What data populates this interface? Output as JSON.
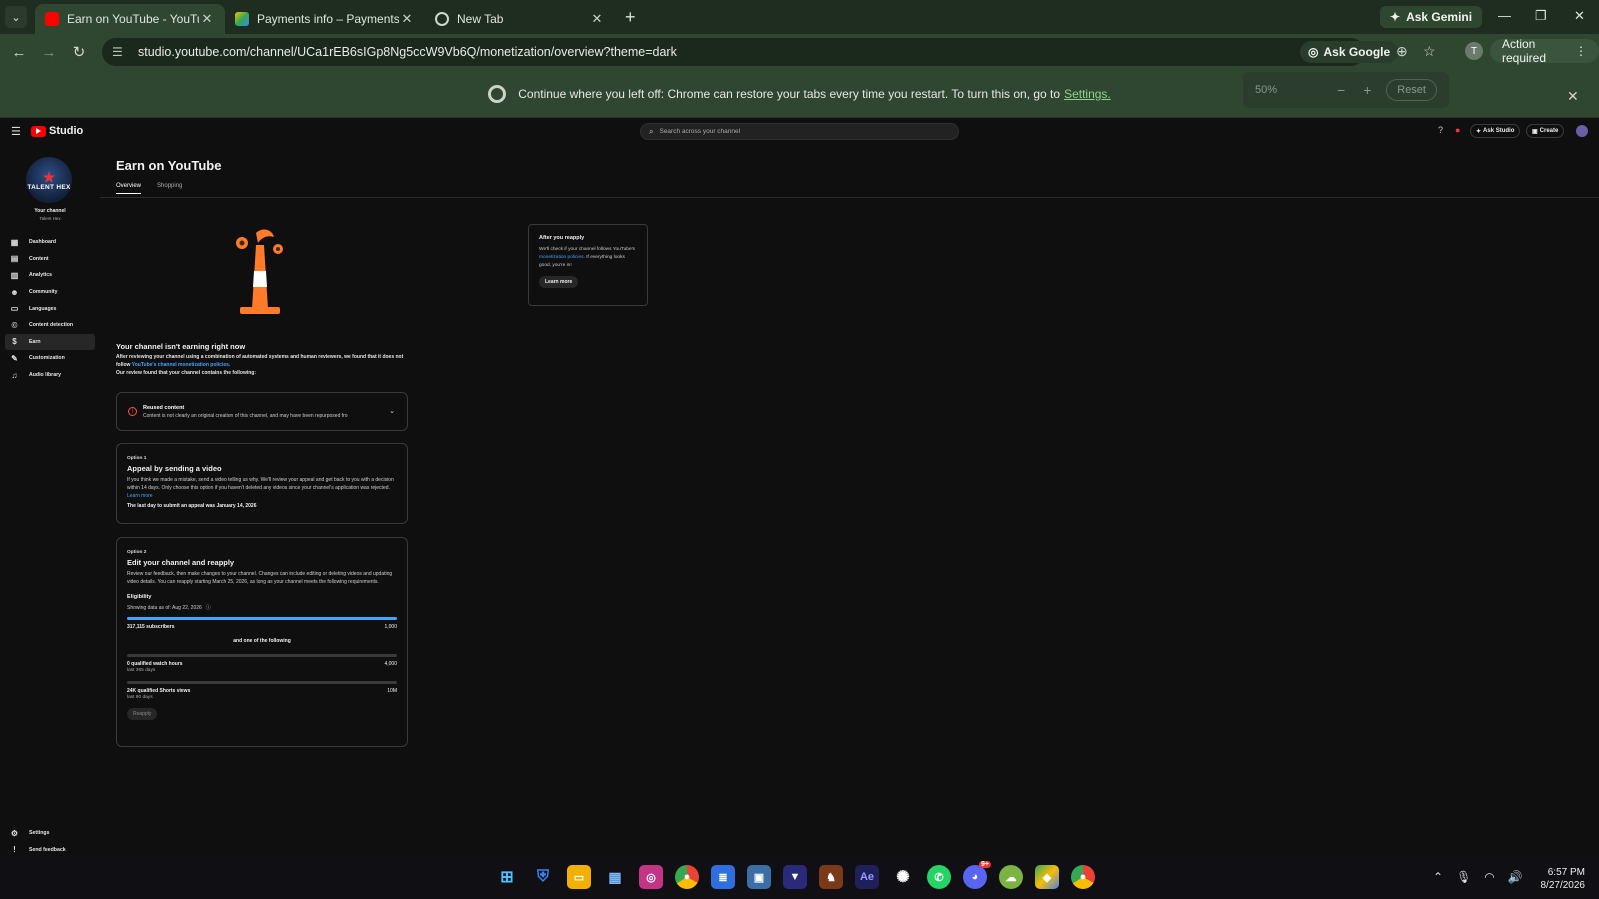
{
  "browser": {
    "tabs": [
      {
        "title": "Earn on YouTube - YouTube Stu",
        "favicon": "youtube-icon",
        "active": true
      },
      {
        "title": "Payments info – Payments – Go",
        "favicon": "google-pay-icon",
        "active": false
      },
      {
        "title": "New Tab",
        "favicon": "chrome-icon",
        "active": false
      }
    ],
    "ask_gemini": "Ask Gemini",
    "url": "studio.youtube.com/channel/UCa1rEB6sIGp8Ng5ccW9Vb6Q/monetization/overview?theme=dark",
    "ask_google": "Ask Google",
    "profile_initial": "T",
    "action_required": "Action required",
    "restore_message": "Continue where you left off: Chrome can restore your tabs every time you restart. To turn this on, go to",
    "restore_link": "Settings.",
    "zoom": {
      "level": "50%",
      "reset": "Reset"
    }
  },
  "studio": {
    "logo_text": "Studio",
    "search_placeholder": "Search across your channel",
    "ask_studio": "Ask Studio",
    "create": "Create"
  },
  "sidebar": {
    "channel_avatar_text": "TALENT HEX",
    "your_channel": "Your channel",
    "channel_name": "Talent Hex",
    "items": [
      {
        "label": "Dashboard",
        "icon": "dashboard-icon"
      },
      {
        "label": "Content",
        "icon": "content-icon"
      },
      {
        "label": "Analytics",
        "icon": "analytics-icon"
      },
      {
        "label": "Community",
        "icon": "community-icon"
      },
      {
        "label": "Languages",
        "icon": "languages-icon"
      },
      {
        "label": "Content detection",
        "icon": "content-detection-icon"
      },
      {
        "label": "Earn",
        "icon": "earn-icon",
        "active": true
      },
      {
        "label": "Customization",
        "icon": "customization-icon"
      },
      {
        "label": "Audio library",
        "icon": "audio-library-icon"
      }
    ],
    "bottom": [
      {
        "label": "Settings",
        "icon": "gear-icon"
      },
      {
        "label": "Send feedback",
        "icon": "feedback-icon"
      }
    ]
  },
  "main": {
    "title": "Earn on YouTube",
    "tabs": [
      "Overview",
      "Shopping"
    ],
    "not_earning_title": "Your channel isn't earning right now",
    "review_text_1": "After reviewing your channel using a combination of automated systems and human reviewers, we found that it does not follow",
    "review_link": "YouTube's channel monetization policies.",
    "review_text_2": "Our review found that your channel contains the following:",
    "reused": {
      "title": "Reused content",
      "desc": "Content is not clearly an original creation of this channel, and may have been repurposed fro"
    },
    "option1": {
      "label": "Option 1",
      "title": "Appeal by sending a video",
      "text": "If you think we made a mistake, send a video telling us why. We'll review your appeal and get back to you with a decision within 14 days. Only choose this option if you haven't deleted any videos since your channel's application was rejected.",
      "link": "Learn more",
      "deadline": "The last day to submit an appeal was January 14, 2026"
    },
    "option2": {
      "label": "Option 2",
      "title": "Edit your channel and reapply",
      "text": "Review our feedback, then make changes to your channel. Changes can include editing or deleting videos and updating video details. You can reapply starting March 25, 2026, as long as your channel meets the following requirements.",
      "eligibility": "Eligibility",
      "showing": "Showing data as of: Aug 22, 2026",
      "subscribers": {
        "label": "317,115 subscribers",
        "target": "1,000",
        "progress": 1.0
      },
      "and_one": "and one of the following",
      "watch_hours": {
        "label": "0 qualified watch hours",
        "sub": "last 365 days",
        "target": "4,000",
        "progress": 0.0
      },
      "shorts": {
        "label": "24K qualified Shorts views",
        "sub": "last 90 days",
        "target": "10M",
        "progress": 0.0
      },
      "reapply": "Reapply"
    },
    "after": {
      "title": "After you reapply",
      "text_1": "We'll check if your channel follows YouTube's",
      "link": "monetization policies",
      "text_2": ". If everything looks good, you're in!",
      "learn_more": "Learn more"
    }
  },
  "taskbar": {
    "time": "6:57 PM",
    "date": "8/27/2026",
    "badge": "9+"
  }
}
